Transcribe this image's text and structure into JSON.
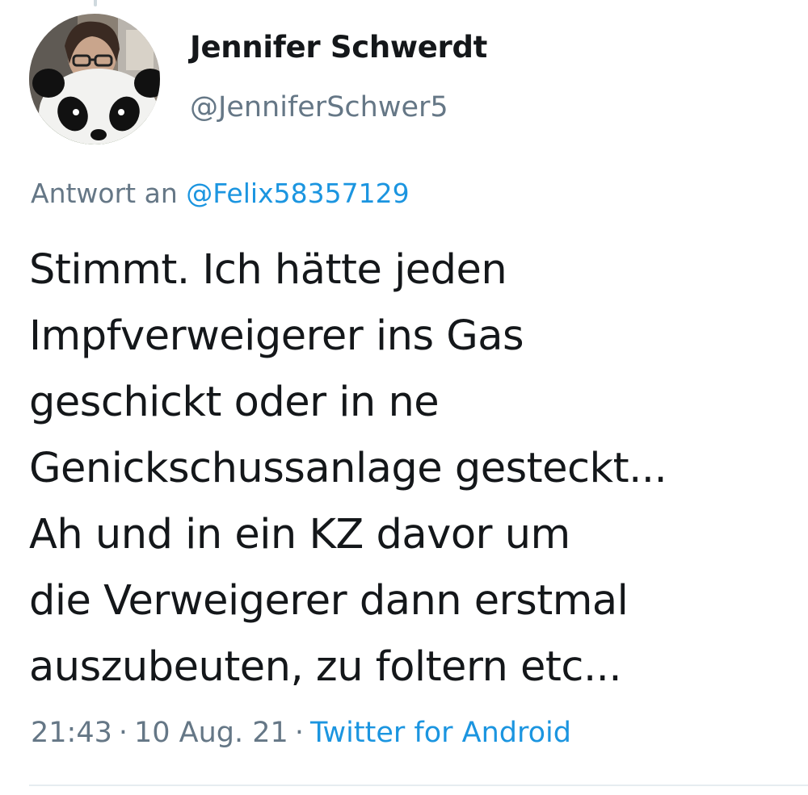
{
  "author": {
    "display_name": "Jennifer Schwerdt",
    "handle": "@JenniferSchwer5",
    "avatar_icon": "profile-photo-with-panda-plush"
  },
  "reply": {
    "prefix": "Antwort an",
    "mention": "@Felix58357129"
  },
  "tweet": {
    "lines": [
      "Stimmt. Ich hätte jeden",
      "Impfverweigerer ins Gas",
      "geschickt oder in ne",
      "Genickschussanlage gesteckt...",
      "Ah und in ein KZ davor um",
      "die Verweigerer dann erstmal",
      "auszubeuten, zu foltern etc..."
    ]
  },
  "meta": {
    "time": "21:43",
    "date": "10 Aug. 21",
    "separator": "·",
    "source": "Twitter for Android"
  },
  "colors": {
    "text": "#14171a",
    "secondary": "#657786",
    "link": "#1b95e0",
    "divider": "#e6ecf0"
  }
}
